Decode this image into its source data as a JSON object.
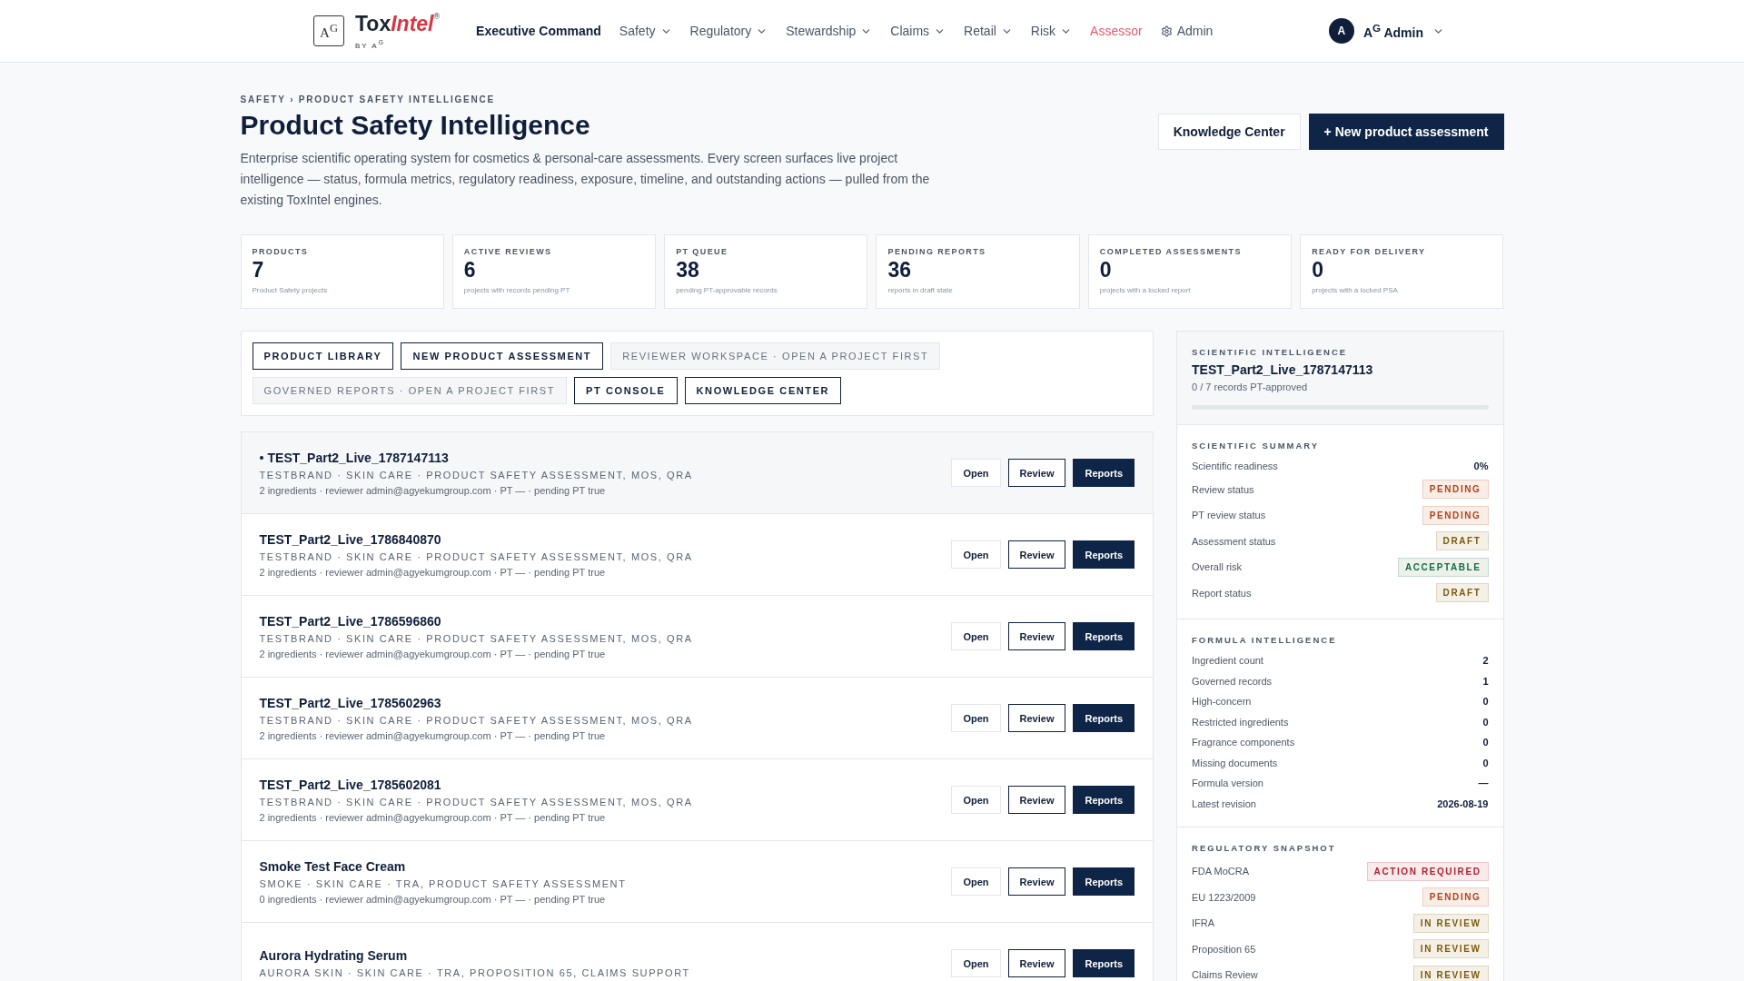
{
  "brand": {
    "icon_text": "A$^{G}$",
    "name_plain": "Tox",
    "name_accent": "Intel",
    "mark": "®",
    "byline": "BY A$^{G}$"
  },
  "nav": [
    {
      "label": "Executive Command",
      "kind": "link",
      "selected": true
    },
    {
      "label": "Safety",
      "kind": "menu",
      "selected": false
    },
    {
      "label": "Regulatory",
      "kind": "menu",
      "selected": false
    },
    {
      "label": "Stewardship",
      "kind": "menu",
      "selected": false
    },
    {
      "label": "Claims",
      "kind": "menu",
      "selected": false
    },
    {
      "label": "Retail",
      "kind": "menu",
      "selected": false
    },
    {
      "label": "Risk",
      "kind": "menu",
      "selected": false
    },
    {
      "label": "Assessor",
      "kind": "accent",
      "selected": false
    },
    {
      "label": "Admin",
      "kind": "settings",
      "selected": false
    }
  ],
  "user": {
    "initial": "A",
    "name": "A$^{G}$ Admin"
  },
  "breadcrumb": "SAFETY › PRODUCT SAFETY INTELLIGENCE",
  "title": "Product Safety Intelligence",
  "description": "Enterprise scientific operating system for cosmetics & personal-care assessments. Every screen surfaces live project intelligence — status, formula metrics, regulatory readiness, exposure, timeline, and outstanding actions — pulled from the existing ToxIntel engines.",
  "header_buttons": [
    {
      "label": "Knowledge Center",
      "kind": "secondary"
    },
    {
      "label": "+ New product assessment",
      "kind": "primary"
    }
  ],
  "stats": [
    {
      "label": "PRODUCTS",
      "value": "7",
      "note": "Product Safety projects"
    },
    {
      "label": "ACTIVE REVIEWS",
      "value": "6",
      "note": "projects with records pending PT"
    },
    {
      "label": "PT QUEUE",
      "value": "38",
      "note": "pending PT-approvable records"
    },
    {
      "label": "PENDING REPORTS",
      "value": "36",
      "note": "reports in draft state"
    },
    {
      "label": "COMPLETED ASSESSMENTS",
      "value": "0",
      "note": "projects with a locked report"
    },
    {
      "label": "READY FOR DELIVERY",
      "value": "0",
      "note": "projects with a locked PSA"
    }
  ],
  "actions": [
    {
      "label": "PRODUCT LIBRARY",
      "disabled": false
    },
    {
      "label": "NEW PRODUCT ASSESSMENT",
      "disabled": false
    },
    {
      "label": "REVIEWER WORKSPACE · OPEN A PROJECT FIRST",
      "disabled": true
    },
    {
      "label": "GOVERNED REPORTS · OPEN A PROJECT FIRST",
      "disabled": true
    },
    {
      "label": "PT CONSOLE",
      "disabled": false
    },
    {
      "label": "KNOWLEDGE CENTER",
      "disabled": false
    }
  ],
  "projects": [
    {
      "name": "TEST_Part2_Live_1787147113",
      "tags": "TESTBRAND · SKIN CARE · PRODUCT SAFETY ASSESSMENT, MOS, QRA",
      "details": "2 ingredients · reviewer admin@agyekumgroup.com · PT — · pending PT true",
      "selected": true,
      "buttons": [
        "Open",
        "Review",
        "Reports"
      ]
    },
    {
      "name": "TEST_Part2_Live_1786840870",
      "tags": "TESTBRAND · SKIN CARE · PRODUCT SAFETY ASSESSMENT, MOS, QRA",
      "details": "2 ingredients · reviewer admin@agyekumgroup.com · PT — · pending PT true",
      "selected": false,
      "buttons": [
        "Open",
        "Review",
        "Reports"
      ]
    },
    {
      "name": "TEST_Part2_Live_1786596860",
      "tags": "TESTBRAND · SKIN CARE · PRODUCT SAFETY ASSESSMENT, MOS, QRA",
      "details": "2 ingredients · reviewer admin@agyekumgroup.com · PT — · pending PT true",
      "selected": false,
      "buttons": [
        "Open",
        "Review",
        "Reports"
      ]
    },
    {
      "name": "TEST_Part2_Live_1785602963",
      "tags": "TESTBRAND · SKIN CARE · PRODUCT SAFETY ASSESSMENT, MOS, QRA",
      "details": "2 ingredients · reviewer admin@agyekumgroup.com · PT — · pending PT true",
      "selected": false,
      "buttons": [
        "Open",
        "Review",
        "Reports"
      ]
    },
    {
      "name": "TEST_Part2_Live_1785602081",
      "tags": "TESTBRAND · SKIN CARE · PRODUCT SAFETY ASSESSMENT, MOS, QRA",
      "details": "2 ingredients · reviewer admin@agyekumgroup.com · PT — · pending PT true",
      "selected": false,
      "buttons": [
        "Open",
        "Review",
        "Reports"
      ]
    },
    {
      "name": "Smoke Test Face Cream",
      "tags": "SMOKE · SKIN CARE · TRA, PRODUCT SAFETY ASSESSMENT",
      "details": "0 ingredients · reviewer admin@agyekumgroup.com · PT — · pending PT true",
      "selected": false,
      "buttons": [
        "Open",
        "Review",
        "Reports"
      ]
    },
    {
      "name": "Aurora Hydrating Serum",
      "tags": "AURORA SKIN · SKIN CARE · TRA, PROPOSITION 65, CLAIMS SUPPORT",
      "selected": false,
      "buttons": [
        "Open",
        "Review",
        "Reports"
      ]
    }
  ],
  "side": {
    "heading": "SCIENTIFIC INTELLIGENCE",
    "project": "TEST_Part2_Live_1787147113",
    "progress_text": "0 / 7 records PT-approved",
    "level": 0,
    "sections": [
      {
        "title": "SCIENTIFIC SUMMARY",
        "rows": [
          {
            "label": "Scientific readiness",
            "kind": "value",
            "value": "0%"
          },
          {
            "label": "Review status",
            "kind": "badge",
            "color": "#b2401b",
            "value": "PENDING"
          },
          {
            "label": "PT review status",
            "kind": "badge",
            "color": "#b2401b",
            "value": "PENDING"
          },
          {
            "label": "Assessment status",
            "kind": "badge",
            "color": "#7d5a0d",
            "value": "DRAFT"
          },
          {
            "label": "Overall risk",
            "kind": "badge",
            "color": "#136b46",
            "value": "ACCEPTABLE"
          },
          {
            "label": "Report status",
            "kind": "badge",
            "color": "#7d5a0d",
            "value": "DRAFT"
          }
        ]
      },
      {
        "title": "FORMULA INTELLIGENCE",
        "rows": [
          {
            "label": "Ingredient count",
            "kind": "value",
            "value": "2"
          },
          {
            "label": "Governed records",
            "kind": "value",
            "value": "1"
          },
          {
            "label": "High-concern",
            "kind": "value",
            "value": "0"
          },
          {
            "label": "Restricted ingredients",
            "kind": "value",
            "value": "0"
          },
          {
            "label": "Fragrance components",
            "kind": "value",
            "value": "0"
          },
          {
            "label": "Missing documents",
            "kind": "value",
            "value": "0"
          },
          {
            "label": "Formula version",
            "kind": "value",
            "value": "—"
          },
          {
            "label": "Latest revision",
            "kind": "value",
            "value": "2026-08-19"
          }
        ]
      },
      {
        "title": "REGULATORY SNAPSHOT",
        "rows": [
          {
            "label": "FDA MoCRA",
            "kind": "badge",
            "color": "#b01f37",
            "value": "ACTION REQUIRED"
          },
          {
            "label": "EU 1223/2009",
            "kind": "badge",
            "color": "#b2401b",
            "value": "PENDING"
          },
          {
            "label": "IFRA",
            "kind": "badge",
            "color": "#7d5a0d",
            "value": "IN REVIEW"
          },
          {
            "label": "Proposition 65",
            "kind": "badge",
            "color": "#7d5a0d",
            "value": "IN REVIEW"
          },
          {
            "label": "Claims Review",
            "kind": "badge",
            "color": "#7d5a0d",
            "value": "IN REVIEW"
          }
        ]
      }
    ]
  }
}
